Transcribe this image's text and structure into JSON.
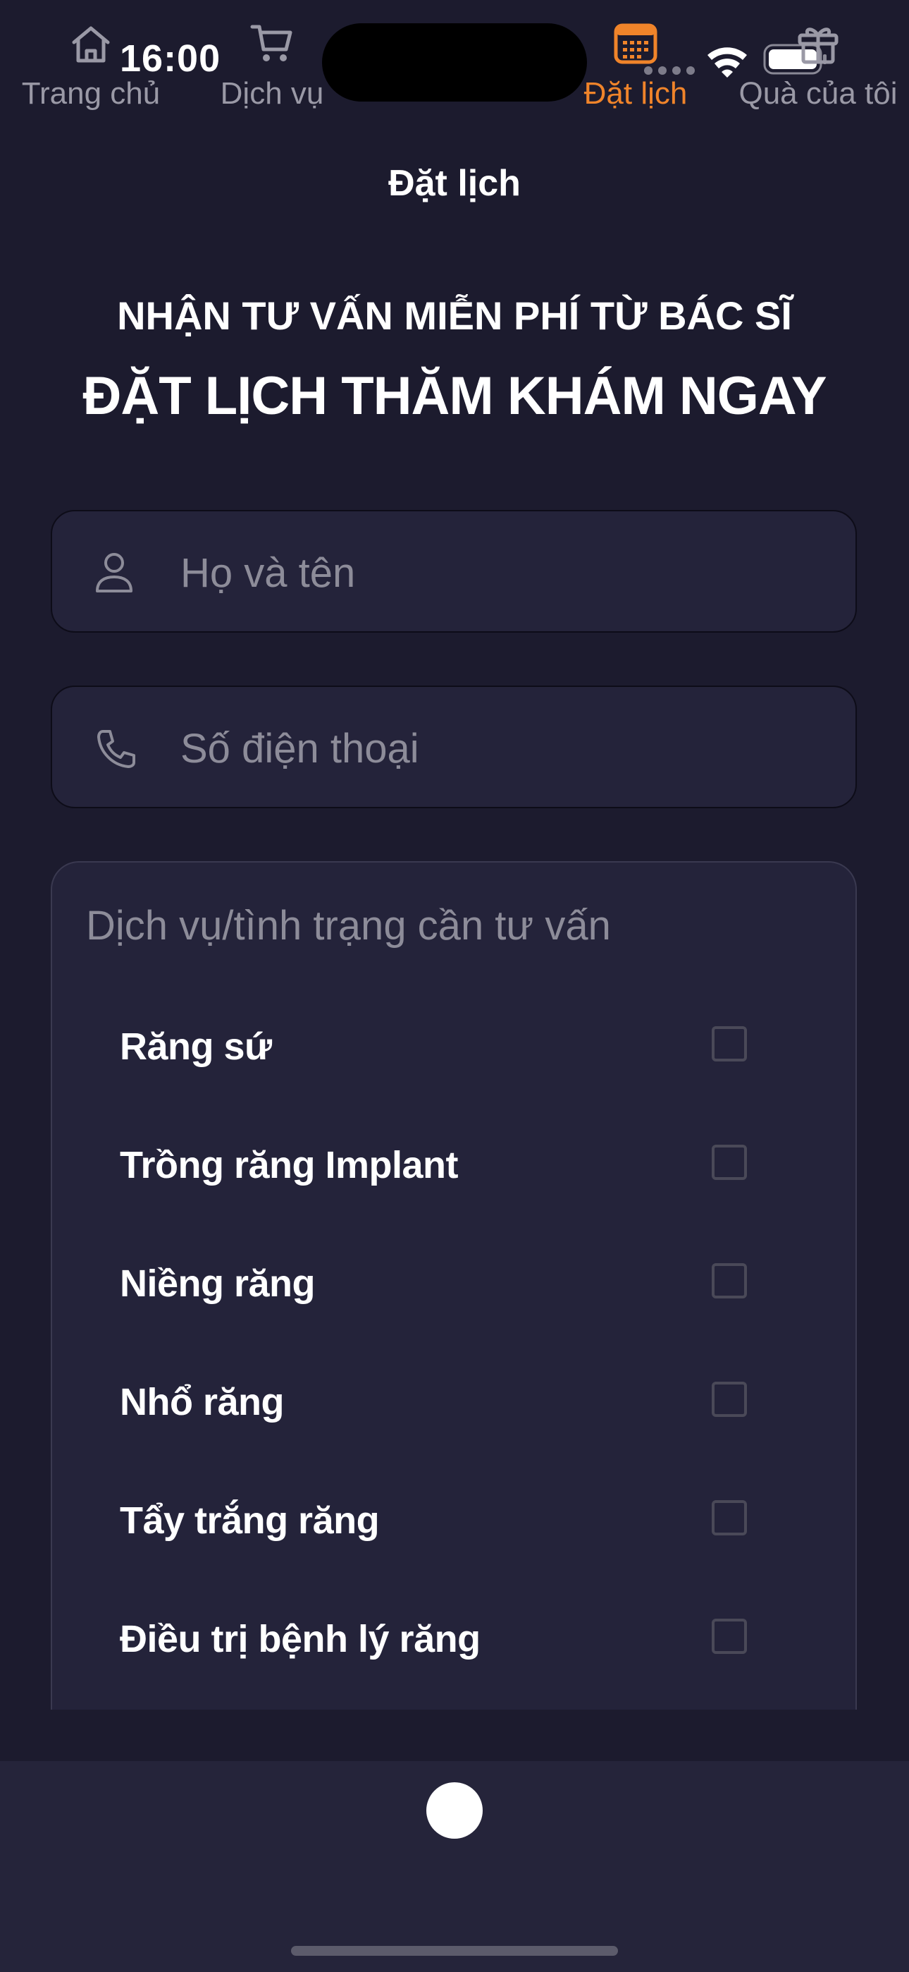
{
  "status_bar": {
    "time": "16:00"
  },
  "nav": {
    "title": "Đặt lịch"
  },
  "hero": {
    "subtitle": "NHẬN TƯ VẤN MIỄN PHÍ TỪ BÁC SĨ",
    "title": "ĐẶT LỊCH THĂM KHÁM NGAY"
  },
  "form": {
    "name_placeholder": "Họ và tên",
    "name_icon": "person-icon",
    "phone_placeholder": "Số điện thoại",
    "phone_icon": "phone-icon"
  },
  "services": {
    "label": "Dịch vụ/tình trạng cần tư vấn",
    "items": [
      {
        "label": "Răng sứ",
        "checked": false
      },
      {
        "label": "Trồng răng Implant",
        "checked": false
      },
      {
        "label": "Niềng răng",
        "checked": false
      },
      {
        "label": "Nhổ răng",
        "checked": false
      },
      {
        "label": "Tẩy trắng răng",
        "checked": false
      },
      {
        "label": "Điều trị bệnh lý răng",
        "checked": false
      }
    ]
  },
  "tab_bar": {
    "active_color": "#f0842a",
    "tabs": [
      {
        "label": "Trang chủ",
        "icon": "home-icon",
        "active": false
      },
      {
        "label": "Dịch vụ",
        "icon": "cart-icon",
        "active": false
      },
      {
        "label": "Đặt lịch",
        "icon": "calendar-icon",
        "active": true
      },
      {
        "label": "Quà của tôi",
        "icon": "gift-icon",
        "active": false
      }
    ]
  }
}
